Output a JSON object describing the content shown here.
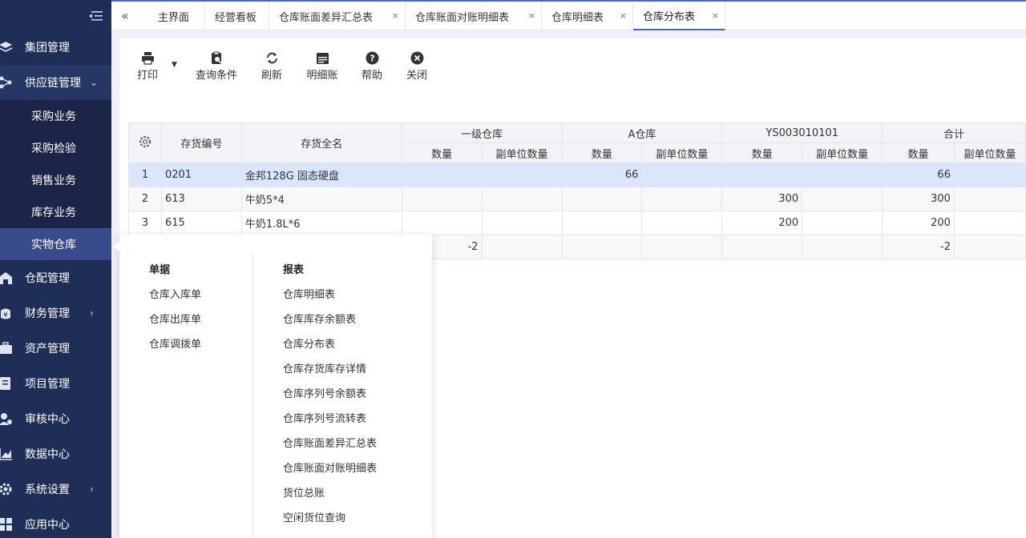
{
  "sidebar": {
    "collapse_icon": "menu-collapse-icon",
    "items": [
      {
        "label": "集团管理",
        "icon": "layers-icon"
      },
      {
        "label": "供应链管理",
        "icon": "supply-chain-icon",
        "chevron": "⌄"
      },
      {
        "label": "仓配管理",
        "icon": "warehouse-icon"
      },
      {
        "label": "财务管理",
        "icon": "finance-icon",
        "chevron": "›"
      },
      {
        "label": "资产管理",
        "icon": "asset-icon"
      },
      {
        "label": "项目管理",
        "icon": "project-icon"
      },
      {
        "label": "审核中心",
        "icon": "audit-icon"
      },
      {
        "label": "数据中心",
        "icon": "chart-icon"
      },
      {
        "label": "系统设置",
        "icon": "gear-icon",
        "chevron": "›"
      },
      {
        "label": "应用中心",
        "icon": "app-icon"
      }
    ],
    "sub_items": [
      "采购业务",
      "采购检验",
      "销售业务",
      "库存业务",
      "实物仓库"
    ]
  },
  "tabs": [
    {
      "label": "主界面"
    },
    {
      "label": "经营看板"
    },
    {
      "label": "仓库账面差异汇总表",
      "close": "×"
    },
    {
      "label": "仓库账面对账明细表",
      "close": "×"
    },
    {
      "label": "仓库明细表",
      "close": "×"
    },
    {
      "label": "仓库分布表",
      "close": "×"
    }
  ],
  "toolbar": {
    "print": "打印",
    "query": "查询条件",
    "refresh": "刷新",
    "detail": "明细账",
    "help": "帮助",
    "close": "关闭"
  },
  "table": {
    "headers": {
      "code": "存货编号",
      "name": "存货全名",
      "groups": [
        "一级仓库",
        "A仓库",
        "YS003010101",
        "合计"
      ],
      "qty": "数量",
      "sub_qty": "副单位数量"
    },
    "rows": [
      {
        "idx": "1",
        "code": "0201",
        "name": "金邦128G 固态硬盘",
        "g1": "",
        "g1s": "",
        "g2": "66",
        "g2s": "",
        "g3": "",
        "g3s": "",
        "g4": "66",
        "g4s": ""
      },
      {
        "idx": "2",
        "code": "613",
        "name": "牛奶5*4",
        "g1": "",
        "g1s": "",
        "g2": "",
        "g2s": "",
        "g3": "300",
        "g3s": "",
        "g4": "300",
        "g4s": ""
      },
      {
        "idx": "3",
        "code": "615",
        "name": "牛奶1.8L*6",
        "g1": "",
        "g1s": "",
        "g2": "",
        "g2s": "",
        "g3": "200",
        "g3s": "",
        "g4": "200",
        "g4s": ""
      },
      {
        "idx": "",
        "code": "",
        "name": "",
        "g1": "-2",
        "g1s": "",
        "g2": "",
        "g2s": "",
        "g3": "",
        "g3s": "",
        "g4": "-2",
        "g4s": ""
      }
    ]
  },
  "flyout": {
    "col1_title": "单据",
    "col1_items": [
      "仓库入库单",
      "仓库出库单",
      "仓库调拨单"
    ],
    "col2_title": "报表",
    "col2_items": [
      "仓库明细表",
      "仓库库存余额表",
      "仓库分布表",
      "仓库存货库存详情",
      "仓库序列号余额表",
      "仓库序列号流转表",
      "仓库账面差异汇总表",
      "仓库账面对账明细表",
      "货位总账",
      "空闲货位查询"
    ]
  },
  "colors": {
    "sidebar": "#1f2e57",
    "accent": "#4a66c8",
    "selected_row": "#dbe5fb"
  }
}
